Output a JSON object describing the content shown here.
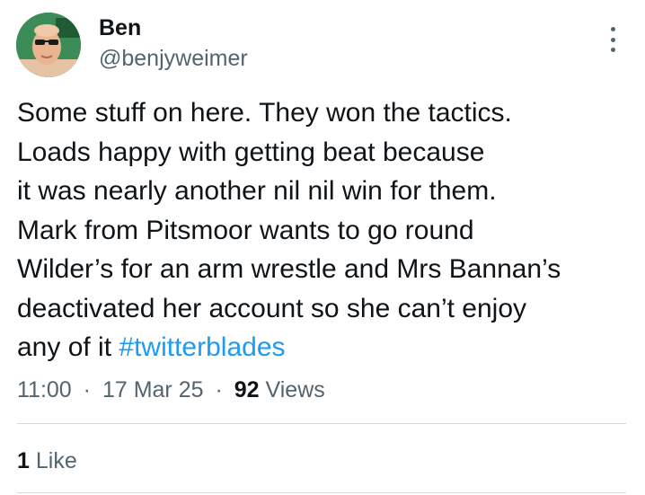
{
  "author": {
    "name": "Ben",
    "handle": "@benjyweimer",
    "avatar_icon": "profile-photo"
  },
  "tweet": {
    "lines": [
      "Some stuff on here. They won the tactics.",
      "Loads happy with getting beat because",
      "it was nearly another nil nil win for them.",
      "Mark from Pitsmoor wants to go round",
      "Wilder’s for an arm wrestle and Mrs Bannan’s",
      "deactivated her account so she can’t enjoy"
    ],
    "last_line_prefix": "any of it ",
    "hashtag": "#twitterblades"
  },
  "meta": {
    "time": "11:00",
    "separator": "·",
    "date": "17 Mar 25",
    "views_count": "92",
    "views_label": "Views"
  },
  "engagement": {
    "likes_count": "1",
    "likes_label": "Like"
  },
  "colors": {
    "text_primary": "#0f1419",
    "text_secondary": "#536471",
    "link": "#1d9bf0",
    "divider": "#cfd9de"
  },
  "icons": {
    "more": "more-options-icon"
  }
}
